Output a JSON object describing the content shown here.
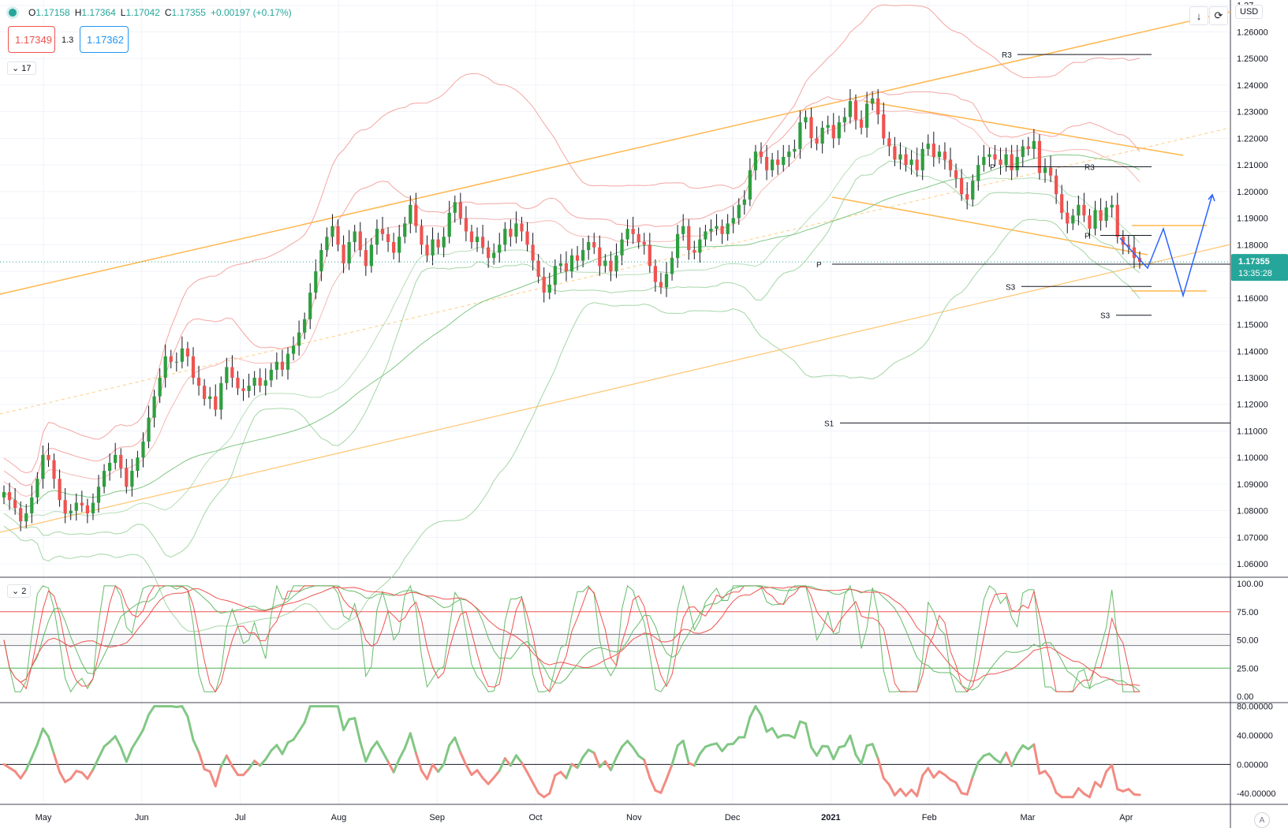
{
  "header": {
    "open_label": "O",
    "open": "1.17158",
    "high_label": "H",
    "high": "1.17364",
    "low_label": "L",
    "low": "1.17042",
    "close_label": "C",
    "close": "1.17355",
    "change": "+0.00197 (+0.17%)",
    "sell_price": "1.17349",
    "spread": "1.3",
    "buy_price": "1.17362",
    "indicators_toggle": "17",
    "stoch_toggle": "2",
    "currency": "USD",
    "auto_label": "A",
    "arrow_icon": "arrow-down-icon",
    "refresh_icon": "refresh-icon",
    "collapse_icon": "chevron-down-icon"
  },
  "colors": {
    "up": "#26a69a",
    "candle_up": "#2e9e3e",
    "candle_down": "#ef5350",
    "band_red": "#f4a6a4",
    "band_green": "#a5d6a7",
    "orange": "#ffb74d",
    "stoch_green": "#66bb6a",
    "stoch_red": "#ef5350",
    "osc_green": "#81c784",
    "osc_red": "#f28b82",
    "projection": "#2962ff",
    "last_price": "#26a69a"
  },
  "chart_data": {
    "type": "candlestick",
    "price_axis": {
      "range": [
        1.055,
        1.272
      ],
      "ticks": [
        "1.06000",
        "1.07000",
        "1.08000",
        "1.09000",
        "1.10000",
        "1.11000",
        "1.12000",
        "1.13000",
        "1.14000",
        "1.15000",
        "1.16000",
        "1.17000",
        "1.18000",
        "1.19000",
        "1.20000",
        "1.21000",
        "1.22000",
        "1.23000",
        "1.24000",
        "1.25000",
        "1.26000",
        "1.27"
      ]
    },
    "last_price": {
      "label": "1.17355",
      "value": 1.17355,
      "countdown": "13:35:28"
    },
    "x_labels": [
      "May",
      "Jun",
      "Jul",
      "Aug",
      "Sep",
      "Oct",
      "Nov",
      "Dec",
      "2021",
      "Feb",
      "Mar",
      "Apr"
    ],
    "closes": [
      1.087,
      1.084,
      1.081,
      1.076,
      1.079,
      1.085,
      1.092,
      1.101,
      1.099,
      1.092,
      1.084,
      1.079,
      1.08,
      1.083,
      1.082,
      1.079,
      1.083,
      1.089,
      1.095,
      1.098,
      1.101,
      1.096,
      1.089,
      1.095,
      1.1,
      1.106,
      1.115,
      1.123,
      1.13,
      1.138,
      1.136,
      1.136,
      1.141,
      1.138,
      1.13,
      1.127,
      1.122,
      1.123,
      1.118,
      1.128,
      1.134,
      1.13,
      1.126,
      1.125,
      1.127,
      1.13,
      1.127,
      1.129,
      1.133,
      1.136,
      1.133,
      1.139,
      1.142,
      1.147,
      1.152,
      1.162,
      1.17,
      1.178,
      1.183,
      1.187,
      1.18,
      1.173,
      1.181,
      1.185,
      1.178,
      1.172,
      1.18,
      1.186,
      1.184,
      1.181,
      1.177,
      1.183,
      1.188,
      1.195,
      1.187,
      1.18,
      1.176,
      1.182,
      1.179,
      1.183,
      1.192,
      1.196,
      1.19,
      1.185,
      1.181,
      1.183,
      1.179,
      1.175,
      1.177,
      1.18,
      1.186,
      1.183,
      1.188,
      1.185,
      1.18,
      1.174,
      1.168,
      1.162,
      1.165,
      1.172,
      1.173,
      1.17,
      1.176,
      1.174,
      1.178,
      1.181,
      1.179,
      1.172,
      1.174,
      1.17,
      1.176,
      1.182,
      1.186,
      1.184,
      1.181,
      1.18,
      1.172,
      1.166,
      1.164,
      1.169,
      1.175,
      1.184,
      1.187,
      1.178,
      1.177,
      1.182,
      1.185,
      1.186,
      1.187,
      1.184,
      1.188,
      1.19,
      1.195,
      1.197,
      1.208,
      1.215,
      1.213,
      1.208,
      1.212,
      1.21,
      1.213,
      1.215,
      1.216,
      1.226,
      1.228,
      1.22,
      1.218,
      1.224,
      1.225,
      1.22,
      1.226,
      1.228,
      1.234,
      1.227,
      1.224,
      1.233,
      1.235,
      1.229,
      1.22,
      1.217,
      1.212,
      1.214,
      1.21,
      1.212,
      1.208,
      1.216,
      1.218,
      1.213,
      1.215,
      1.212,
      1.208,
      1.205,
      1.199,
      1.197,
      1.204,
      1.21,
      1.213,
      1.214,
      1.212,
      1.21,
      1.214,
      1.208,
      1.213,
      1.217,
      1.216,
      1.219,
      1.207,
      1.209,
      1.206,
      1.199,
      1.192,
      1.188,
      1.191,
      1.195,
      1.191,
      1.186,
      1.193,
      1.189,
      1.194,
      1.195,
      1.183,
      1.18,
      1.179,
      1.175,
      1.1735
    ],
    "support_resistance": [
      {
        "label": "R3",
        "value": 1.2515
      },
      {
        "label": "R3",
        "value": 1.2093
      },
      {
        "label": "P",
        "value": 1.2093
      },
      {
        "label": "P",
        "value": 1.1835
      },
      {
        "label": "P",
        "value": 1.1727
      },
      {
        "label": "S3",
        "value": 1.1643
      },
      {
        "label": "S3",
        "value": 1.1535
      },
      {
        "label": "S1",
        "value": 1.113
      }
    ],
    "stochastic": {
      "range": [
        0,
        100
      ],
      "ticks": [
        "100.00",
        "75.00",
        "50.00",
        "25.00",
        "0.00"
      ],
      "levels": [
        80,
        75,
        55,
        45,
        25
      ]
    },
    "oscillator": {
      "range": [
        -55,
        85
      ],
      "ticks": [
        "80.00000",
        "40.00000",
        "0.00000",
        "-40.00000"
      ]
    }
  }
}
